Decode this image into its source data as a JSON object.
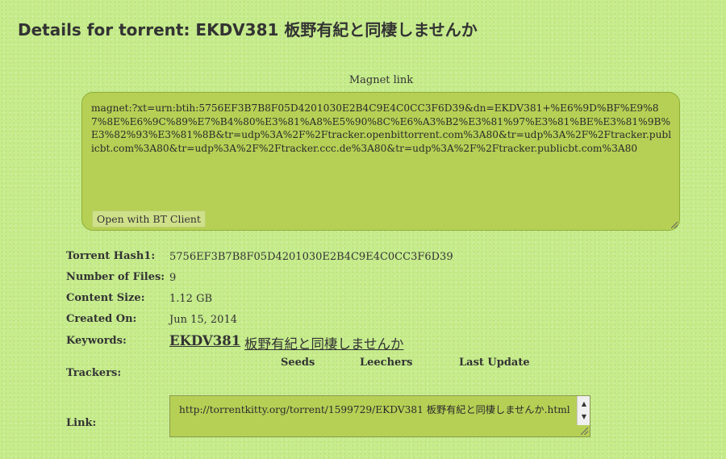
{
  "page": {
    "title": "Details for torrent: EKDV381 板野有紀と同棲しませんか"
  },
  "magnet": {
    "label": "Magnet link",
    "text": "magnet:?xt=urn:btih:5756EF3B7B8F05D4201030E2B4C9E4C0CC3F6D39&dn=EKDV381+%E6%9D%BF%E9%87%8E%E6%9C%89%E7%B4%80%E3%81%A8%E5%90%8C%E6%A3%B2%E3%81%97%E3%81%BE%E3%81%9B%E3%82%93%E3%81%8B&tr=udp%3A%2F%2Ftracker.openbittorrent.com%3A80&tr=udp%3A%2F%2Ftracker.publicbt.com%3A80&tr=udp%3A%2F%2Ftracker.ccc.de%3A80&tr=udp%3A%2F%2Ftracker.publicbt.com%3A80",
    "open_button": "Open with BT Client"
  },
  "details": {
    "hash_label": "Torrent Hash1:",
    "hash_value": "5756EF3B7B8F05D4201030E2B4C9E4C0CC3F6D39",
    "files_label": "Number of Files:",
    "files_value": "9",
    "size_label": "Content Size:",
    "size_value": "1.12 GB",
    "created_label": "Created On:",
    "created_value": "Jun 15, 2014",
    "keywords_label": "Keywords:",
    "keywords": [
      "EKDV381",
      "板野有紀と同棲しませんか"
    ],
    "trackers_label": "Trackers:",
    "tracker_columns": [
      "Seeds",
      "Leechers",
      "Last Update"
    ],
    "link_label": "Link:",
    "link_value": "http://torrentkitty.org/torrent/1599729/EKDV381 板野有紀と同棲しませんか.html"
  }
}
